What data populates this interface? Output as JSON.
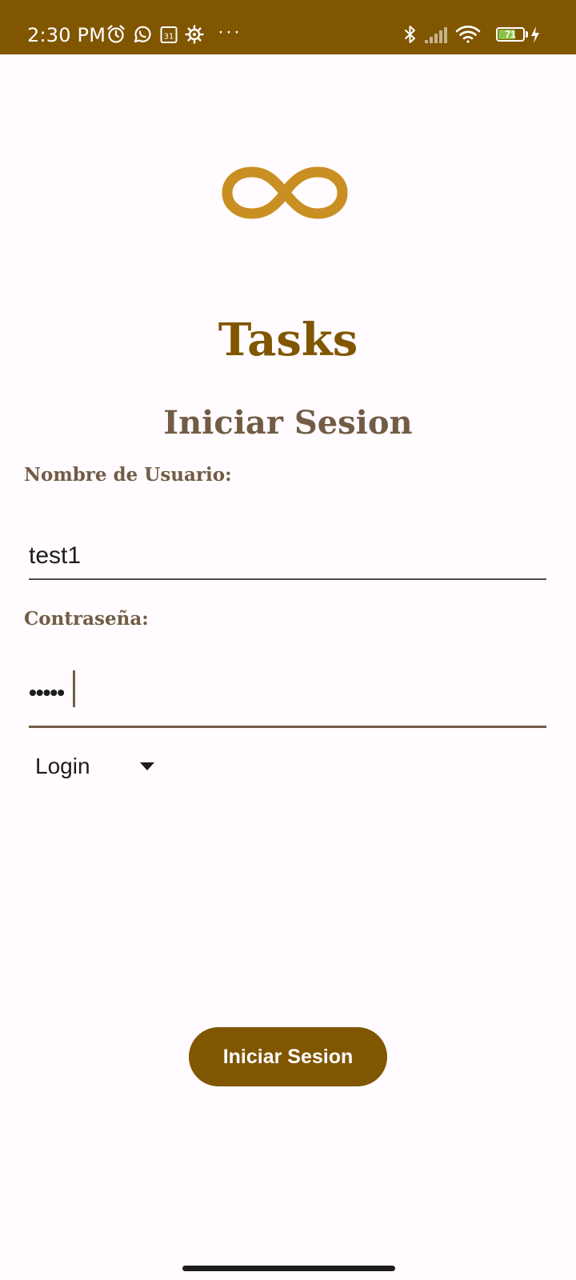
{
  "status_bar": {
    "time": "2:30 PM",
    "more_indicator": "···",
    "battery_level": "71",
    "battery_fraction": 0.71,
    "background_color": "#805600",
    "icons": [
      "alarm-icon",
      "whatsapp-icon",
      "calendar-icon",
      "settings-icon",
      "bluetooth-icon",
      "signal-icon",
      "wifi-icon",
      "battery-icon",
      "charging-icon"
    ]
  },
  "app": {
    "title": "Tasks",
    "logo_icon": "infinity-icon",
    "logo_color": "#c98f22"
  },
  "login": {
    "heading": "Iniciar Sesion",
    "username_label": "Nombre de Usuario:",
    "username_value": "test1",
    "password_label": "Contraseña:",
    "password_masked": "•••••",
    "mode_selected": "Login",
    "submit_label": "Iniciar Sesion"
  },
  "colors": {
    "primary": "#805600",
    "secondary_text": "#725c45",
    "background": "#fffbfe",
    "battery_fill": "#8bc34a"
  }
}
